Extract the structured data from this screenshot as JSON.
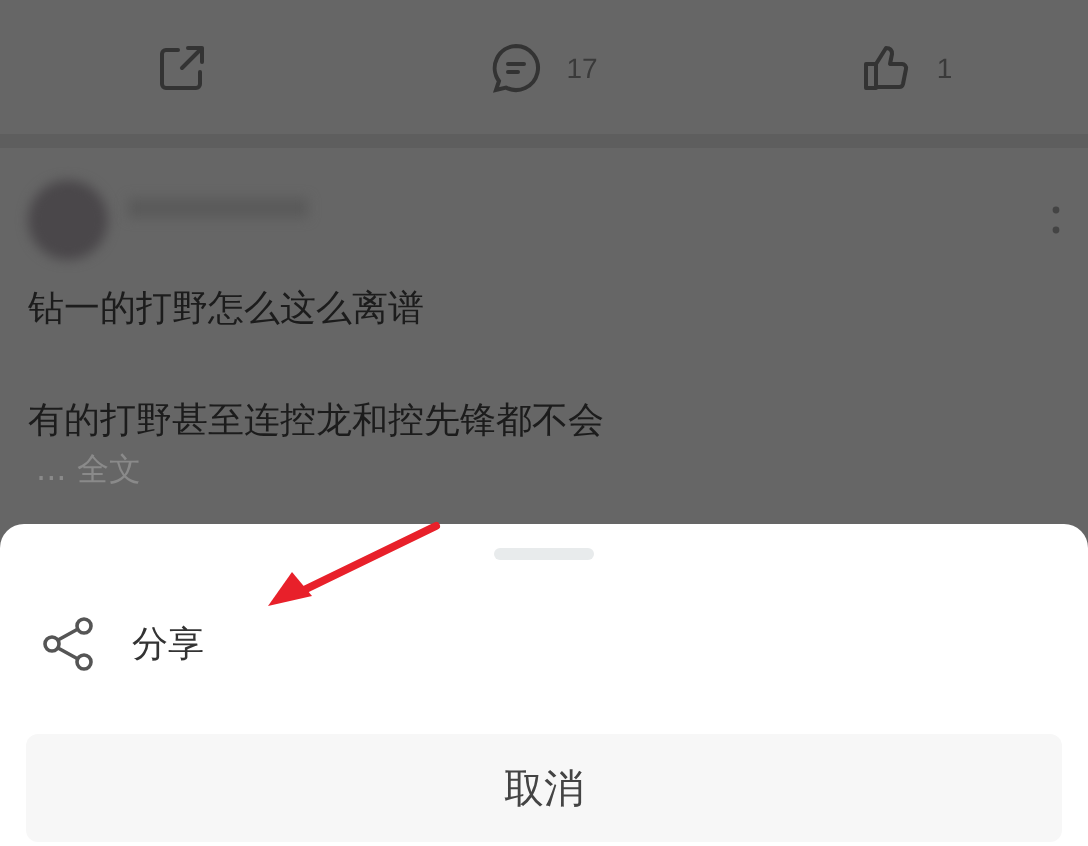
{
  "action_bar": [
    {
      "kind": "share"
    },
    {
      "kind": "comment",
      "count": "17"
    },
    {
      "kind": "like",
      "count": "1"
    }
  ],
  "post": {
    "lines": [
      "钻一的打野怎么这么离谱",
      "有的打野甚至连控龙和控先锋都不会"
    ],
    "more": "... 全文"
  },
  "sheet": {
    "items": [
      {
        "kind": "share",
        "label": "分享"
      }
    ],
    "cancel": "取消"
  }
}
